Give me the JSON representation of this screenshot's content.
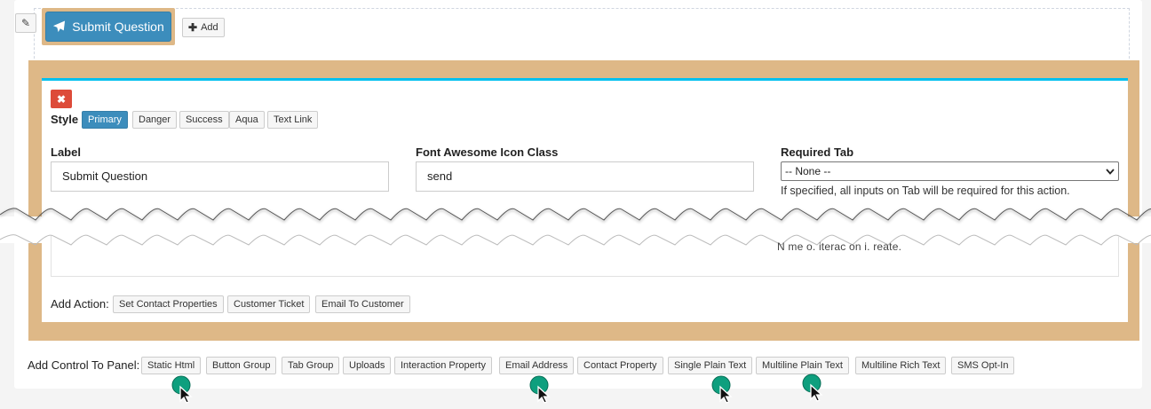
{
  "top_bar": {
    "submit_label": "Submit Question",
    "add_label": "Add"
  },
  "style_section": {
    "label": "Style",
    "options": [
      "Primary",
      "Danger",
      "Success",
      "Aqua",
      "Text Link"
    ],
    "selected": "Primary"
  },
  "fields": {
    "label": {
      "title": "Label",
      "value": "Submit Question"
    },
    "icon_class": {
      "title": "Font Awesome Icon Class",
      "value": "send"
    },
    "required_tab": {
      "title": "Required Tab",
      "value": "-- None --",
      "hint": "If specified, all inputs on Tab will be required for this action."
    }
  },
  "torn_fragment": "N me o. iterac on i. reate.",
  "add_action": {
    "label": "Add Action:",
    "items": [
      "Set Contact Properties",
      "Customer Ticket",
      "Email To Customer"
    ]
  },
  "add_control": {
    "label": "Add Control To Panel:",
    "items": [
      "Static Html",
      "Button Group",
      "Tab Group",
      "Uploads",
      "Interaction Property",
      "Email Address",
      "Contact Property",
      "Single Plain Text",
      "Multiline Plain Text",
      "Multiline Rich Text",
      "SMS Opt-In"
    ]
  },
  "colors": {
    "primary": "#3c8dbc",
    "danger": "#dd4b39",
    "tan": "#deb887",
    "accent_top": "#00c0ef",
    "cursor_dot": "#0e9f7e"
  }
}
